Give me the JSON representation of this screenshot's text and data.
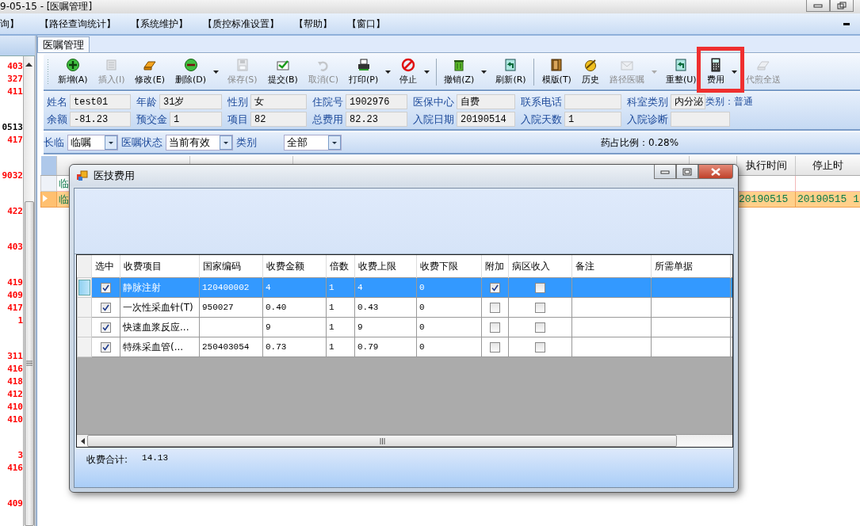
{
  "window": {
    "title": "9-05-15 - [医嘱管理]"
  },
  "menu": [
    {
      "label": "询】"
    },
    {
      "label": "【路径查询统计】"
    },
    {
      "label": "【系统维护】"
    },
    {
      "label": "【质控标准设置】"
    },
    {
      "label": "【帮助】"
    },
    {
      "label": "【窗口】"
    }
  ],
  "left_list": {
    "groups": [
      [
        {
          "text": "403",
          "color": "#ff0000"
        },
        {
          "text": "327",
          "color": "#ff0000"
        },
        {
          "text": "411",
          "color": "#ff0000"
        }
      ],
      [
        {
          "text": "0513",
          "color": "#000000"
        },
        {
          "text": "417",
          "color": "#ff0000"
        }
      ],
      [
        {
          "text": "9032",
          "color": "#ff0000"
        }
      ],
      [
        {
          "text": "422",
          "color": "#ff0000"
        }
      ],
      [
        {
          "text": "403",
          "color": "#ff0000"
        }
      ],
      [
        {
          "text": "419",
          "color": "#ff0000"
        },
        {
          "text": "409",
          "color": "#ff0000"
        },
        {
          "text": "417",
          "color": "#ff0000"
        },
        {
          "text": "1",
          "color": "#ff0000"
        }
      ],
      [
        {
          "text": "311",
          "color": "#ff0000"
        },
        {
          "text": "416",
          "color": "#ff0000"
        },
        {
          "text": "418",
          "color": "#ff0000"
        },
        {
          "text": "412",
          "color": "#ff0000"
        },
        {
          "text": "410",
          "color": "#ff0000"
        },
        {
          "text": "410",
          "color": "#ff0000"
        }
      ],
      [
        {
          "text": "3",
          "color": "#ff0000"
        },
        {
          "text": "416",
          "color": "#ff0000"
        }
      ],
      [
        {
          "text": "409",
          "color": "#ff0000"
        }
      ]
    ]
  },
  "tabs": [
    {
      "label": "医嘱管理",
      "selected": true
    }
  ],
  "toolbar": [
    {
      "label": "新增(A)",
      "disabled": false,
      "dropdown": false,
      "separator_after": false
    },
    {
      "label": "插入(I)",
      "disabled": true,
      "dropdown": false,
      "separator_after": false
    },
    {
      "label": "修改(E)",
      "disabled": false,
      "dropdown": false,
      "separator_after": false
    },
    {
      "label": "删除(D)",
      "disabled": false,
      "dropdown": true,
      "separator_after": false
    },
    {
      "label": "保存(S)",
      "disabled": true,
      "dropdown": false,
      "separator_after": false
    },
    {
      "label": "提交(B)",
      "disabled": false,
      "dropdown": false,
      "separator_after": false
    },
    {
      "label": "取消(C)",
      "disabled": true,
      "dropdown": false,
      "separator_after": false
    },
    {
      "label": "打印(P)",
      "disabled": false,
      "dropdown": true,
      "separator_after": false
    },
    {
      "label": "停止",
      "disabled": false,
      "dropdown": true,
      "separator_after": true
    },
    {
      "label": "撤销(Z)",
      "disabled": false,
      "dropdown": true,
      "separator_after": false
    },
    {
      "label": "刷新(R)",
      "disabled": false,
      "dropdown": false,
      "separator_after": true
    },
    {
      "label": "模版(T)",
      "disabled": false,
      "dropdown": false,
      "separator_after": false
    },
    {
      "label": "历史",
      "disabled": false,
      "dropdown": false,
      "separator_after": false
    },
    {
      "label": "路径医嘱",
      "disabled": true,
      "dropdown": true,
      "separator_after": false
    },
    {
      "label": "重整(U)",
      "disabled": false,
      "dropdown": false,
      "separator_after": false
    },
    {
      "label": "费用",
      "disabled": false,
      "dropdown": true,
      "separator_after": false
    },
    {
      "label": "代煎全送",
      "disabled": true,
      "dropdown": false,
      "separator_after": false
    }
  ],
  "patient_info": {
    "rows": [
      [
        {
          "label": "姓名",
          "value": "test01"
        },
        {
          "label": "年龄",
          "value": "31岁"
        },
        {
          "label": "性别",
          "value": "女"
        },
        {
          "label": "住院号",
          "value": "1902976"
        },
        {
          "label": "医保中心",
          "value": "自费"
        },
        {
          "label": "联系电话"
        },
        {
          "label": "科室类别",
          "value": "内分泌",
          "note": "类别：普通"
        }
      ],
      [
        {
          "label": "余额",
          "value": "-81.23"
        },
        {
          "label": "预交金",
          "value": "1"
        },
        {
          "label": "项目",
          "value": "82"
        },
        {
          "label": "总费用",
          "value": "82.23"
        },
        {
          "label": "入院日期",
          "value": "20190514"
        },
        {
          "label": "入院天数",
          "value": "1"
        },
        {
          "label": "入院诊断"
        }
      ]
    ]
  },
  "filters": [
    {
      "label": "长临",
      "value": "临嘱"
    },
    {
      "label": "医嘱状态",
      "value": "当前有效"
    },
    {
      "label": "类别",
      "value": "全部"
    }
  ],
  "drug_ratio": "药占比例：0.28%",
  "orders_table": {
    "columns": [
      "执行时间",
      "停止时"
    ],
    "rows": [
      {
        "selected": false,
        "type": "临"
      },
      {
        "selected": true,
        "type": "临",
        "exec_time": "20190515",
        "stop_time": "20190515 1"
      }
    ]
  },
  "dialog": {
    "title": "医技费用",
    "columns": [
      "选中",
      "收费项目",
      "国家编码",
      "收费金额",
      "倍数",
      "收费上限",
      "收费下限",
      "附加",
      "病区收入",
      "备注",
      "所需单据"
    ],
    "rows": [
      {
        "selected": true,
        "checked": true,
        "item": "静脉注射",
        "code": "120400002",
        "amount": "4",
        "multiple": "1",
        "upper": "4",
        "lower": "0",
        "extra": true,
        "ward_income": false
      },
      {
        "selected": false,
        "checked": true,
        "item": "一次性采血针(T)",
        "code": "950027",
        "amount": "0.40",
        "multiple": "1",
        "upper": "0.43",
        "lower": "0",
        "extra": false,
        "ward_income": false
      },
      {
        "selected": false,
        "checked": true,
        "item": "快速血浆反应...",
        "amount": "9",
        "multiple": "1",
        "upper": "9",
        "lower": "0",
        "extra": false,
        "ward_income": false
      },
      {
        "selected": false,
        "checked": true,
        "item": "特殊采血管(...",
        "code": "250403054",
        "amount": "0.73",
        "multiple": "1",
        "upper": "0.79",
        "lower": "0",
        "extra": false,
        "ward_income": false
      }
    ],
    "total_label": "收费合计:",
    "total": "14.13"
  }
}
